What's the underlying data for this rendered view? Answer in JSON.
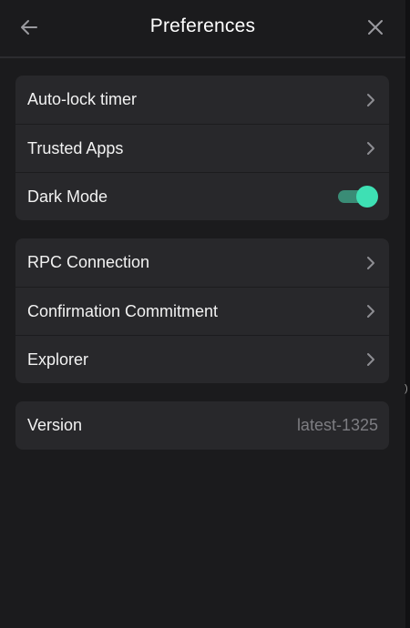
{
  "header": {
    "title": "Preferences",
    "back_icon": "arrow-left-icon",
    "close_icon": "close-icon"
  },
  "groups": [
    {
      "items": [
        {
          "label": "Auto-lock timer",
          "control": "chevron-right-icon"
        },
        {
          "label": "Trusted Apps",
          "control": "chevron-right-icon"
        },
        {
          "label": "Dark Mode",
          "control": "toggle",
          "toggle_on": true
        }
      ]
    },
    {
      "items": [
        {
          "label": "RPC Connection",
          "control": "chevron-right-icon"
        },
        {
          "label": "Confirmation Commitment",
          "control": "chevron-right-icon"
        },
        {
          "label": "Explorer",
          "control": "chevron-right-icon"
        }
      ]
    },
    {
      "items": [
        {
          "label": "Version",
          "value": "latest-1325"
        }
      ]
    }
  ],
  "edge_glyph": ")",
  "colors": {
    "background": "#1b1b1d",
    "card": "#28282b",
    "accent": "#3ee0b4",
    "muted_text": "#7d7d82"
  }
}
